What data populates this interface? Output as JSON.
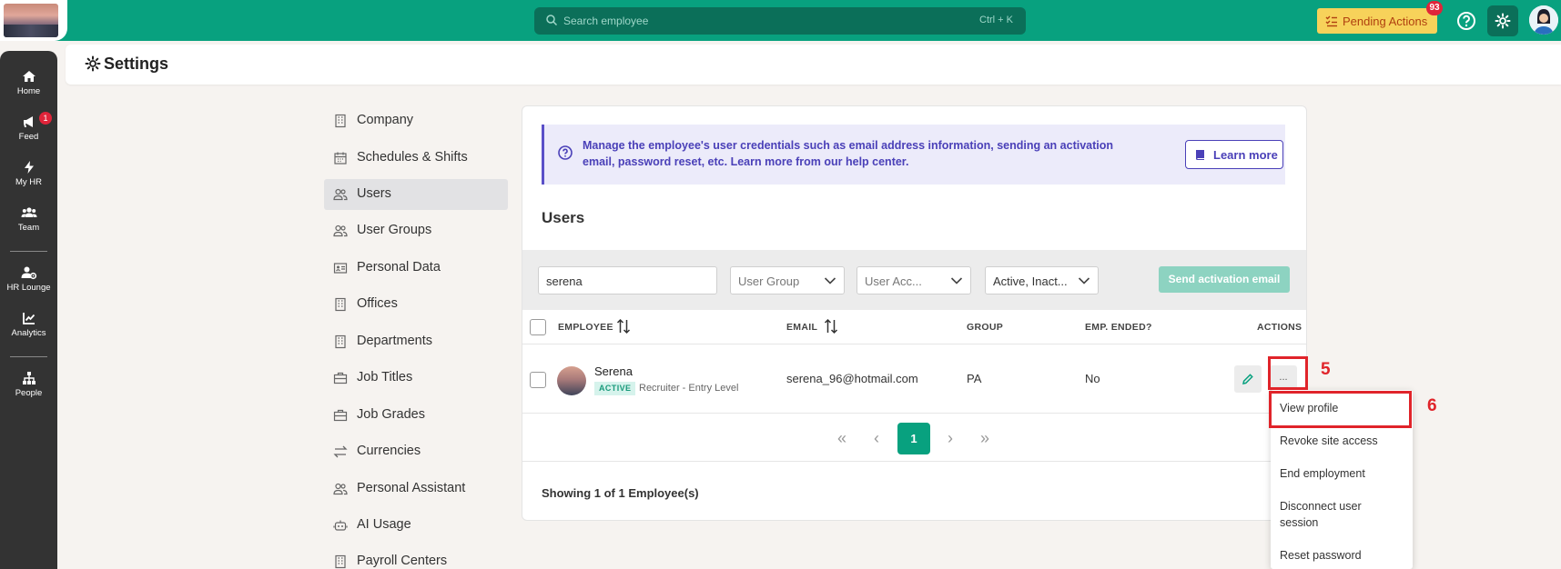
{
  "topbar": {
    "search_placeholder": "Search employee",
    "search_shortcut": "Ctrl + K",
    "pending_label": "Pending Actions",
    "pending_count": "93"
  },
  "sidebar": {
    "items": [
      {
        "label": "Home",
        "icon": "home-icon"
      },
      {
        "label": "Feed",
        "icon": "megaphone-icon",
        "badge": "1"
      },
      {
        "label": "My HR",
        "icon": "bolt-icon"
      },
      {
        "label": "Team",
        "icon": "team-icon"
      },
      {
        "label": "HR Lounge",
        "icon": "user-gear-icon"
      },
      {
        "label": "Analytics",
        "icon": "chart-icon"
      },
      {
        "label": "People",
        "icon": "org-chart-icon"
      }
    ]
  },
  "header": {
    "title": "Settings"
  },
  "settings_menu": [
    {
      "label": "Company"
    },
    {
      "label": "Schedules & Shifts"
    },
    {
      "label": "Users",
      "active": true
    },
    {
      "label": "User Groups"
    },
    {
      "label": "Personal Data"
    },
    {
      "label": "Offices"
    },
    {
      "label": "Departments"
    },
    {
      "label": "Job Titles"
    },
    {
      "label": "Job Grades"
    },
    {
      "label": "Currencies"
    },
    {
      "label": "Personal Assistant"
    },
    {
      "label": "AI Usage"
    },
    {
      "label": "Payroll Centers"
    }
  ],
  "info": {
    "text": "Manage the employee's user credentials such as email address information, sending an activation email, password reset, etc. Learn more from our help center.",
    "learn_more": "Learn more"
  },
  "users": {
    "title": "Users",
    "filters": {
      "search_value": "serena",
      "user_group": "User Group",
      "user_access": "User Acc...",
      "status": "Active, Inact..."
    },
    "send_activation": "Send activation email",
    "columns": {
      "employee": "EMPLOYEE",
      "email": "EMAIL",
      "group": "GROUP",
      "emp_ended": "EMP. ENDED?",
      "actions": "ACTIONS"
    },
    "rows": [
      {
        "name": "Serena",
        "status": "ACTIVE",
        "role": "Recruiter - Entry Level",
        "email": "serena_96@hotmail.com",
        "group": "PA",
        "emp_ended": "No",
        "more": "..."
      }
    ],
    "pagination": {
      "first": "«",
      "prev": "‹",
      "current": "1",
      "next": "›",
      "last": "»"
    },
    "showing": "Showing 1 of 1 Employee(s)"
  },
  "actions_menu": [
    "View profile",
    "Revoke site access",
    "End employment",
    "Disconnect user session",
    "Reset password"
  ],
  "annotations": {
    "step5": "5",
    "step6": "6"
  },
  "colors": {
    "brand": "#08a17f",
    "info_accent": "#4a40b8",
    "annotation_red": "#e0242a"
  }
}
